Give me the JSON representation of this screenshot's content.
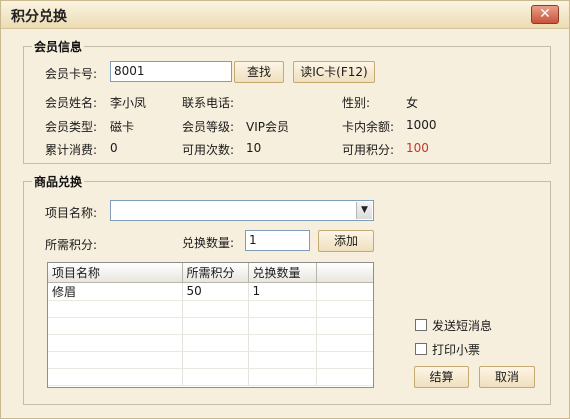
{
  "window": {
    "title": "积分兑换",
    "close_glyph": "✕"
  },
  "member": {
    "legend": "会员信息",
    "card_label": "会员卡号:",
    "card_value": "8001",
    "find_button": "查找",
    "read_ic_button": "读IC卡(F12)",
    "name_label": "会员姓名:",
    "name_value": "李小凤",
    "phone_label": "联系电话:",
    "phone_value": "",
    "gender_label": "性别:",
    "gender_value": "女",
    "type_label": "会员类型:",
    "type_value": "磁卡",
    "level_label": "会员等级:",
    "level_value": "VIP会员",
    "balance_label": "卡内余额:",
    "balance_value": "1000",
    "total_label": "累计消费:",
    "total_value": "0",
    "times_label": "可用次数:",
    "times_value": "10",
    "points_label": "可用积分:",
    "points_value": "100",
    "points_color": "#c0392b"
  },
  "goods": {
    "legend": "商品兑换",
    "item_label": "项目名称:",
    "item_value": "",
    "required_label": "所需积分:",
    "qty_label": "兑换数量:",
    "qty_value": "1",
    "add_button": "添加",
    "table": {
      "headers": [
        "项目名称",
        "所需积分",
        "兑换数量"
      ],
      "rows": [
        [
          "修眉",
          "50",
          "1"
        ]
      ]
    },
    "sms_label": "发送短消息",
    "print_label": "打印小票",
    "checkout_button": "结算",
    "cancel_button": "取消"
  }
}
